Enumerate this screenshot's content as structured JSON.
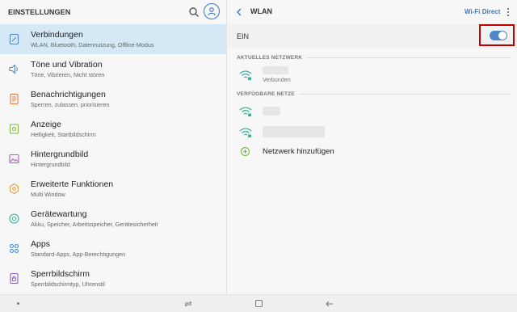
{
  "left": {
    "title": "EINSTELLUNGEN",
    "items": [
      {
        "label": "Verbindungen",
        "sub": "WLAN, Bluetooth, Datennutzung, Offline-Modus",
        "icon": "connections-icon",
        "active": true
      },
      {
        "label": "Töne und Vibration",
        "sub": "Töne, Vibrieren, Nicht stören",
        "icon": "sound-icon"
      },
      {
        "label": "Benachrichtigungen",
        "sub": "Sperren, zulassen, priorisieren",
        "icon": "notifications-icon"
      },
      {
        "label": "Anzeige",
        "sub": "Helligkeit, Startbildschirm",
        "icon": "display-icon"
      },
      {
        "label": "Hintergrundbild",
        "sub": "Hintergrundbild",
        "icon": "wallpaper-icon"
      },
      {
        "label": "Erweiterte Funktionen",
        "sub": "Multi Window",
        "icon": "advanced-features-icon"
      },
      {
        "label": "Gerätewartung",
        "sub": "Akku, Speicher, Arbeitsspeicher, Gerätesicherheit",
        "icon": "device-maintenance-icon"
      },
      {
        "label": "Apps",
        "sub": "Standard-Apps, App-Berechtigungen",
        "icon": "apps-icon"
      },
      {
        "label": "Sperrbildschirm",
        "sub": "Sperrbildschirmtyp, Uhrenstil",
        "icon": "lock-screen-icon"
      }
    ]
  },
  "right": {
    "title": "WLAN",
    "wifi_direct": "Wi-Fi Direct",
    "toggle_label": "EIN",
    "toggle_on": true,
    "current_section": "AKTUELLES NETZWERK",
    "current_status": "Verbunden",
    "available_section": "VERFÜGBARE NETZE",
    "add_network": "Netzwerk hinzufügen"
  },
  "colors": {
    "accent": "#3b78c1",
    "active_bg": "#d5e8f6",
    "highlight": "#c00000",
    "add_green": "#6fb33b"
  }
}
